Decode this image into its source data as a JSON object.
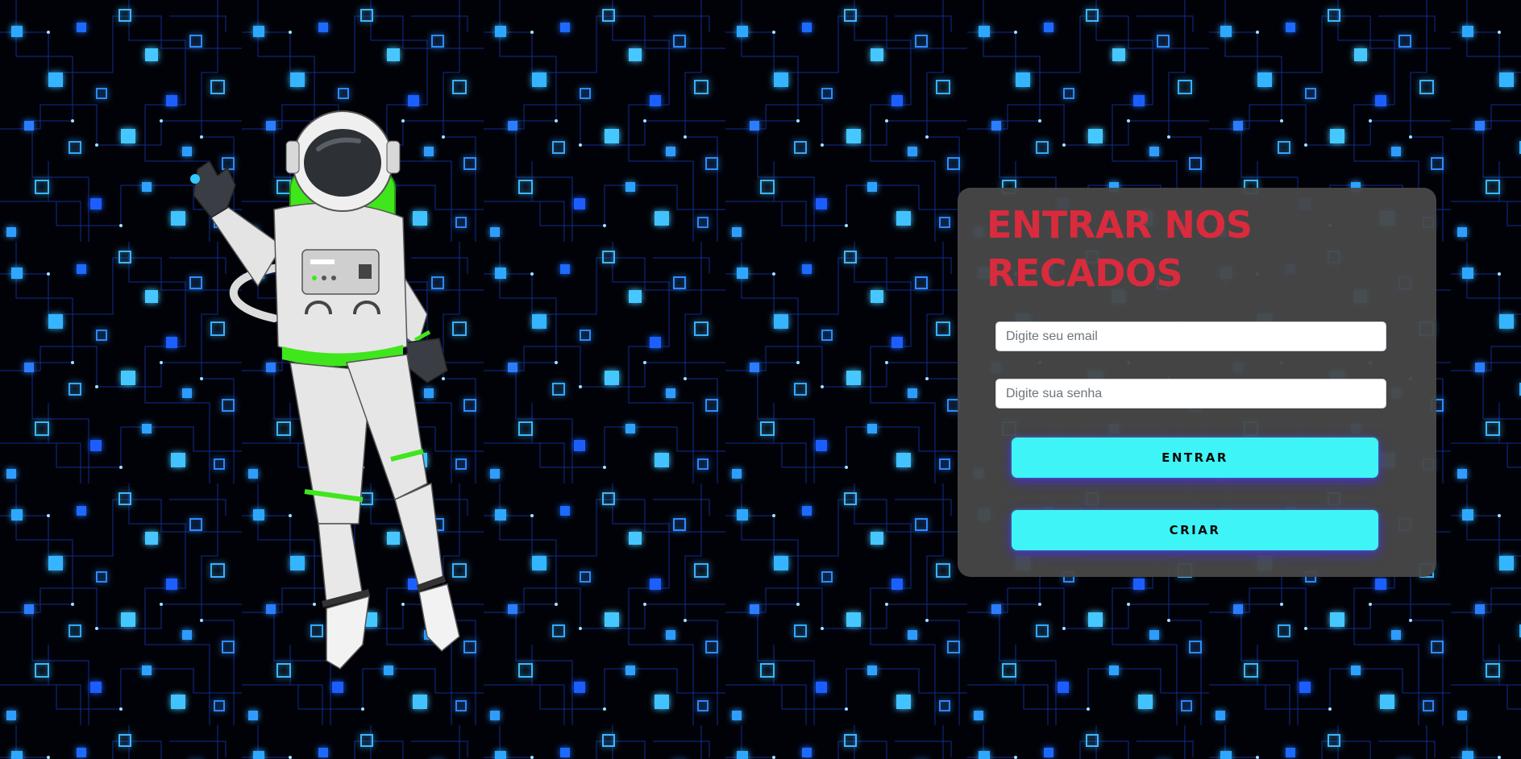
{
  "colors": {
    "background": "#010208",
    "circuit_glow": "#37b9ff",
    "card_background": "#484848",
    "title": "#d92b3d",
    "button": "#3ff4f6",
    "astronaut_accent": "#3fe61c"
  },
  "hero": {
    "illustration": "astronaut-illustration"
  },
  "login": {
    "title": "ENTRAR NOS RECADOS",
    "email_placeholder": "Digite seu email",
    "password_placeholder": "Digite sua senha",
    "enter_label": "ENTRAR",
    "create_label": "CRIAR"
  }
}
